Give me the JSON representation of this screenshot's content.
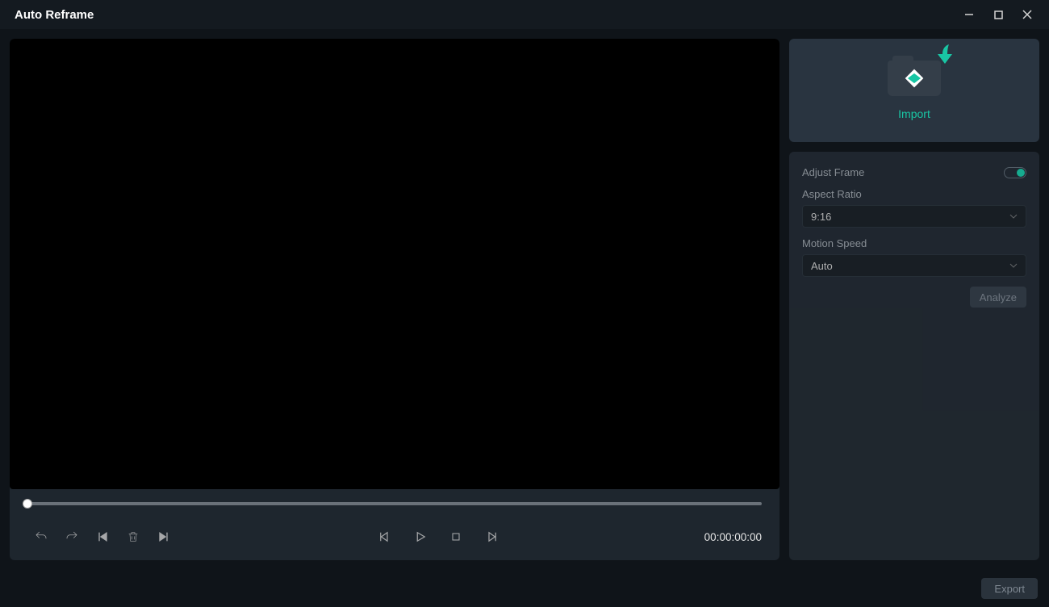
{
  "window": {
    "title": "Auto Reframe"
  },
  "player": {
    "timecode": "00:00:00:00"
  },
  "sidebar": {
    "import_label": "Import",
    "adjust_frame_label": "Adjust Frame",
    "adjust_frame_enabled": true,
    "aspect_ratio_label": "Aspect Ratio",
    "aspect_ratio_value": "9:16",
    "motion_speed_label": "Motion Speed",
    "motion_speed_value": "Auto",
    "analyze_label": "Analyze"
  },
  "footer": {
    "export_label": "Export"
  },
  "colors": {
    "accent": "#19c6a4",
    "bg": "#0f1419",
    "panel": "#222a33"
  }
}
